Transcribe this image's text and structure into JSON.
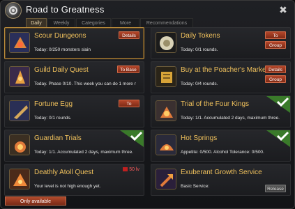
{
  "window": {
    "title": "Road to Greatness"
  },
  "tabs": [
    "Daily",
    "Weekly",
    "Categories",
    "More",
    "Recommendations"
  ],
  "cards": [
    {
      "title": "Scour Dungeons",
      "desc": "Today: 0/250 monsters slain",
      "buttons": [
        "Details"
      ],
      "completed": false,
      "icon": "dungeon-icon"
    },
    {
      "title": "Daily Tokens",
      "desc": "Today: 0/1 rounds.",
      "buttons": [
        "To",
        "Group"
      ],
      "completed": false,
      "icon": "token-icon"
    },
    {
      "title": "Guild Daily Quest",
      "desc": "Today. Phase 0/10. This week you can do 1 more r",
      "buttons": [
        "To Base"
      ],
      "completed": false,
      "icon": "guild-icon"
    },
    {
      "title": "Buy at the Poacher's Market",
      "desc": "Today: 0/4 rounds.",
      "buttons": [
        "Details",
        "Group"
      ],
      "completed": false,
      "icon": "market-icon"
    },
    {
      "title": "Fortune Egg",
      "desc": "Today: 0/1 rounds.",
      "buttons": [
        "To"
      ],
      "completed": false,
      "icon": "egg-icon"
    },
    {
      "title": "Trial of the Four Kings",
      "desc": "Today: 1/1. Accumulated 2 days, maximum three.",
      "buttons": [],
      "completed": true,
      "icon": "kings-icon"
    },
    {
      "title": "Guardian Trials",
      "desc": "Today: 1/1. Accumulated 2 days, maximum three.",
      "buttons": [],
      "completed": true,
      "icon": "guardian-icon"
    },
    {
      "title": "Hot Springs",
      "desc": "Appetite: 0/500. Alcohol Tolerance: 0/500.",
      "buttons": [],
      "completed": true,
      "icon": "springs-icon"
    },
    {
      "title": "Deathly Atoll Quest",
      "desc": "Your level is not high enough yet.",
      "buttons": [],
      "completed": false,
      "level": "50 lv",
      "icon": "atoll-icon"
    },
    {
      "title": "Exuberant Growth Service",
      "desc": "Basic Service:",
      "buttons": [
        "Release"
      ],
      "completed": false,
      "icon": "growth-icon"
    }
  ],
  "footer": {
    "button": "Only available"
  },
  "colors": {
    "accent": "#f0c15c",
    "button": "#9a3a20",
    "check": "#7ccf3a"
  }
}
